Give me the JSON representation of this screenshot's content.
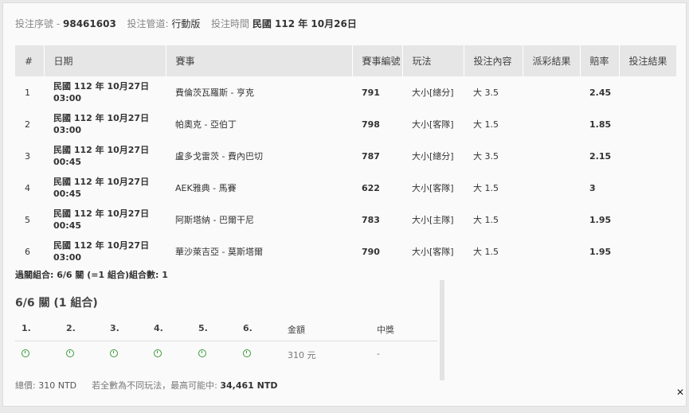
{
  "header": {
    "serial_label": "投注序號",
    "serial_value": "98461603",
    "channel_label": "投注管道:",
    "channel_value": "行動版",
    "time_label": "投注時間",
    "time_value": "民國 112 年 10月26日"
  },
  "table": {
    "columns": [
      "#",
      "日期",
      "賽事",
      "賽事編號",
      "玩法",
      "投注內容",
      "派彩結果",
      "賠率",
      "投注結果"
    ],
    "rows": [
      {
        "no": "1",
        "date1": "民國 112 年 10月27日",
        "date2": "03:00",
        "match": "費倫茨瓦羅斯 - 亨克",
        "id": "791",
        "play": "大小[總分]",
        "bet": "大 3.5",
        "payout": "",
        "odds": "2.45",
        "result": ""
      },
      {
        "no": "2",
        "date1": "民國 112 年 10月27日",
        "date2": "03:00",
        "match": "帕奧克 - 亞伯丁",
        "id": "798",
        "play": "大小[客隊]",
        "bet": "大 1.5",
        "payout": "",
        "odds": "1.85",
        "result": ""
      },
      {
        "no": "3",
        "date1": "民國 112 年 10月27日",
        "date2": "00:45",
        "match": "盧多戈雷茨 - 費內巴切",
        "id": "787",
        "play": "大小[總分]",
        "bet": "大 3.5",
        "payout": "",
        "odds": "2.15",
        "result": ""
      },
      {
        "no": "4",
        "date1": "民國 112 年 10月27日",
        "date2": "00:45",
        "match": "AEK雅典 - 馬賽",
        "id": "622",
        "play": "大小[客隊]",
        "bet": "大 1.5",
        "payout": "",
        "odds": "3",
        "result": ""
      },
      {
        "no": "5",
        "date1": "民國 112 年 10月27日",
        "date2": "00:45",
        "match": "阿斯塔納 - 巴爾干尼",
        "id": "783",
        "play": "大小[主隊]",
        "bet": "大 1.5",
        "payout": "",
        "odds": "1.95",
        "result": ""
      },
      {
        "no": "6",
        "date1": "民國 112 年 10月27日",
        "date2": "03:00",
        "match": "華沙萊吉亞 - 莫斯塔爾",
        "id": "790",
        "play": "大小[客隊]",
        "bet": "大 1.5",
        "payout": "",
        "odds": "1.95",
        "result": ""
      }
    ]
  },
  "summary_line": "過關組合: 6/6 關 (=1 組合)組合數: 1",
  "combo": {
    "title": "6/6 關 (1 組合)",
    "headers": [
      "1.",
      "2.",
      "3.",
      "4.",
      "5.",
      "6.",
      "金額",
      "中獎"
    ],
    "amount": "310 元",
    "prize": "-",
    "status_icons": [
      "clock-icon",
      "clock-icon",
      "clock-icon",
      "clock-icon",
      "clock-icon",
      "clock-icon"
    ]
  },
  "footer": {
    "total_label": "總價:",
    "total_value": "310 NTD",
    "note": "若全數為不同玩法，最高可能中:",
    "max_value": "34,461 NTD"
  },
  "close_label": "✕"
}
